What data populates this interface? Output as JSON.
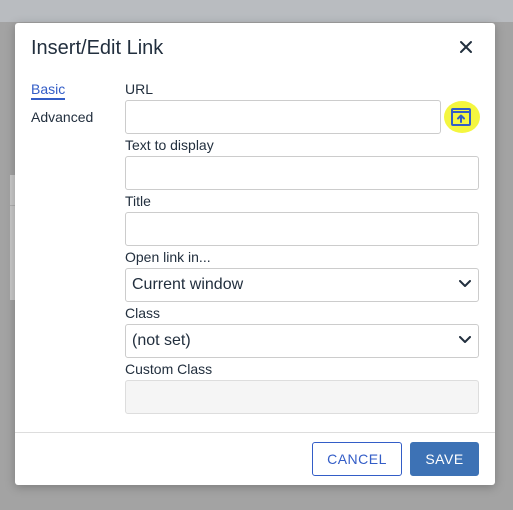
{
  "dialog": {
    "title": "Insert/Edit Link",
    "close_icon": "close-icon"
  },
  "tabs": [
    {
      "label": "Basic",
      "active": true
    },
    {
      "label": "Advanced",
      "active": false
    }
  ],
  "form": {
    "url": {
      "label": "URL",
      "value": "",
      "browse_icon": "upload-browse-icon"
    },
    "text_to_display": {
      "label": "Text to display",
      "value": ""
    },
    "title": {
      "label": "Title",
      "value": ""
    },
    "open_link_in": {
      "label": "Open link in...",
      "selected": "Current window"
    },
    "class": {
      "label": "Class",
      "selected": "(not set)"
    },
    "custom_class": {
      "label": "Custom Class",
      "value": ""
    }
  },
  "footer": {
    "cancel_label": "CANCEL",
    "save_label": "SAVE"
  },
  "colors": {
    "accent": "#335dc7",
    "save_bg": "#3d72b5",
    "highlight": "#f2f51d"
  }
}
